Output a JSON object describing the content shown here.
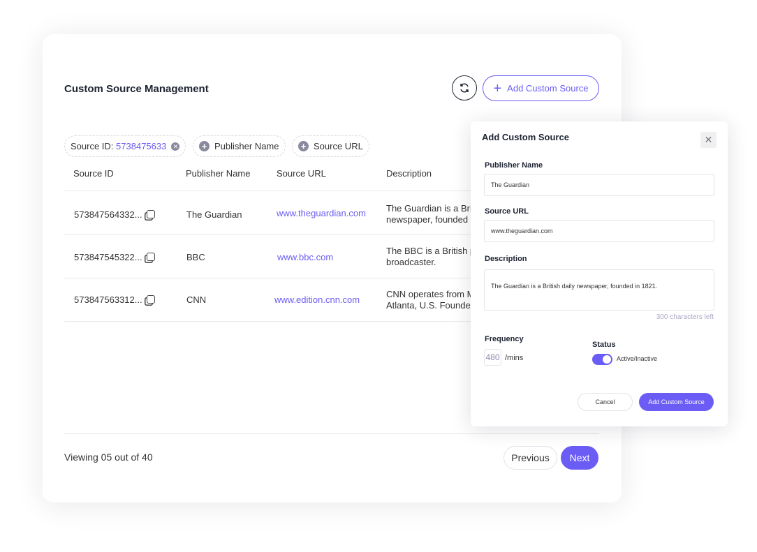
{
  "header": {
    "title": "Custom Source Management",
    "add_button": "Add Custom Source"
  },
  "filters": [
    {
      "label": "Source ID:",
      "value": "5738475633"
    },
    {
      "label": "Publisher Name"
    },
    {
      "label": "Source URL"
    }
  ],
  "table": {
    "columns": [
      "Source ID",
      "Publisher Name",
      "Source URL",
      "Description"
    ],
    "rows": [
      {
        "id": "573847564332...",
        "publisher": "The Guardian",
        "url": "www.theguardian.com",
        "description": "The Guardian is a British daily newspaper, founded in 1821."
      },
      {
        "id": "573847545322...",
        "publisher": "BBC",
        "url": "www.bbc.com",
        "description": "The BBC is a British public service broadcaster."
      },
      {
        "id": "573847563312...",
        "publisher": "CNN",
        "url": "www.edition.cnn.com",
        "description": "CNN operates from Midtown Atlanta, U.S. Founded in 1980."
      }
    ]
  },
  "footer": {
    "viewing": "Viewing 05 out of 40",
    "previous": "Previous",
    "next": "Next"
  },
  "modal": {
    "title": "Add Custom Source",
    "publisher_label": "Publisher Name",
    "publisher_value": "The Guardian",
    "url_label": "Source URL",
    "url_value": "www.theguardian.com",
    "description_label": "Description",
    "description_value": "The Guardian is a British daily newspaper, founded in 1821.",
    "chars_left": "300 characters left",
    "frequency_label": "Frequency",
    "frequency_value": "480",
    "frequency_unit": "/mins",
    "status_label": "Status",
    "status_toggle": "Active/Inactive",
    "status_active": true,
    "cancel": "Cancel",
    "submit": "Add Custom Source"
  },
  "colors": {
    "accent": "#6a5cf5"
  }
}
